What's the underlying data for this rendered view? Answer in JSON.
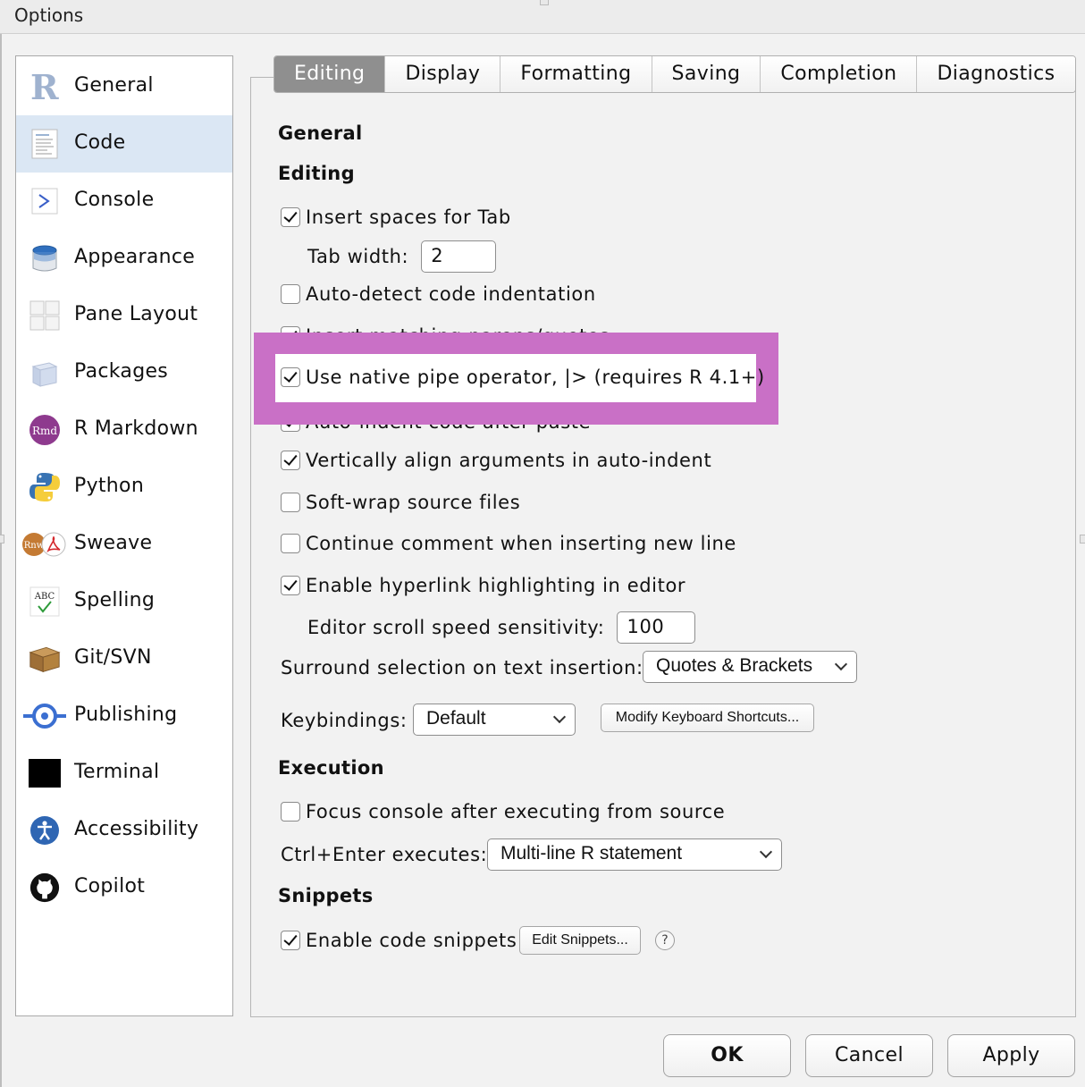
{
  "window": {
    "title": "Options"
  },
  "sidebar": {
    "items": [
      {
        "label": "General"
      },
      {
        "label": "Code"
      },
      {
        "label": "Console"
      },
      {
        "label": "Appearance"
      },
      {
        "label": "Pane Layout"
      },
      {
        "label": "Packages"
      },
      {
        "label": "R Markdown"
      },
      {
        "label": "Python"
      },
      {
        "label": "Sweave"
      },
      {
        "label": "Spelling"
      },
      {
        "label": "Git/SVN"
      },
      {
        "label": "Publishing"
      },
      {
        "label": "Terminal"
      },
      {
        "label": "Accessibility"
      },
      {
        "label": "Copilot"
      }
    ],
    "selected": "Code",
    "icon_text": {
      "rmd": "Rmd",
      "rnw": "Rnw",
      "abc": "ABC"
    }
  },
  "tabs": [
    {
      "label": "Editing"
    },
    {
      "label": "Display"
    },
    {
      "label": "Formatting"
    },
    {
      "label": "Saving"
    },
    {
      "label": "Completion"
    },
    {
      "label": "Diagnostics"
    }
  ],
  "active_tab": "Editing",
  "content": {
    "general_title": "General",
    "editing_title": "Editing",
    "insert_spaces": {
      "label": "Insert spaces for Tab",
      "checked": true
    },
    "tab_width": {
      "label": "Tab width:",
      "value": "2"
    },
    "auto_detect": {
      "label": "Auto-detect code indentation",
      "checked": false
    },
    "insert_matching": {
      "label": "Insert matching parens/quotes",
      "checked": true
    },
    "native_pipe": {
      "label": "Use native pipe operator, |> (requires R 4.1+)",
      "checked": true
    },
    "auto_indent_paste": {
      "label": "Auto-indent code after paste",
      "checked": true
    },
    "vertical_align": {
      "label": "Vertically align arguments in auto-indent",
      "checked": true
    },
    "soft_wrap": {
      "label": "Soft-wrap source files",
      "checked": false
    },
    "continue_comment": {
      "label": "Continue comment when inserting new line",
      "checked": false
    },
    "hyperlink": {
      "label": "Enable hyperlink highlighting in editor",
      "checked": true
    },
    "scroll_speed": {
      "label": "Editor scroll speed sensitivity:",
      "value": "100"
    },
    "surround": {
      "label": "Surround selection on text insertion:",
      "value": "Quotes & Brackets"
    },
    "keybindings": {
      "label": "Keybindings:",
      "value": "Default",
      "button": "Modify Keyboard Shortcuts..."
    },
    "execution_title": "Execution",
    "focus_console": {
      "label": "Focus console after executing from source",
      "checked": false
    },
    "ctrl_enter": {
      "label": "Ctrl+Enter executes:",
      "value": "Multi-line R statement"
    },
    "snippets_title": "Snippets",
    "enable_snippets": {
      "label": "Enable code snippets",
      "checked": true,
      "button": "Edit Snippets..."
    },
    "help": "?"
  },
  "footer": {
    "ok": "OK",
    "cancel": "Cancel",
    "apply": "Apply"
  },
  "colors": {
    "highlight": "#c970c6",
    "selected_row": "#dbe7f4",
    "active_tab": "#8f8f8f"
  }
}
